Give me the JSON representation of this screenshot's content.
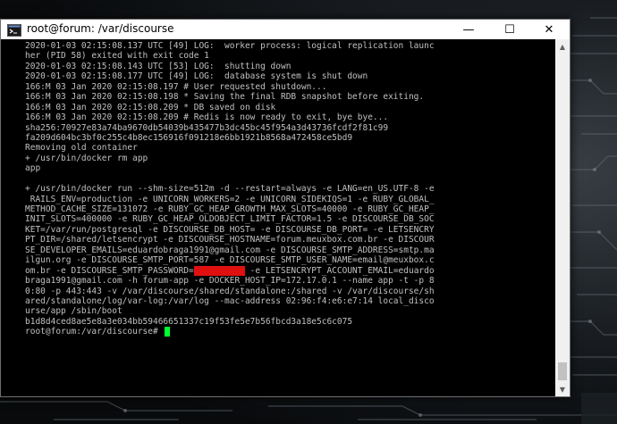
{
  "window": {
    "title": "root@forum: /var/discourse",
    "minimize_glyph": "—",
    "maximize_glyph": "☐",
    "close_glyph": "✕",
    "icon": "terminal-icon"
  },
  "terminal": {
    "lines": [
      "2020-01-03 02:15:08.137 UTC [49] LOG:  worker process: logical replication launc",
      "her (PID 58) exited with exit code 1",
      "2020-01-03 02:15:08.143 UTC [53] LOG:  shutting down",
      "2020-01-03 02:15:08.177 UTC [49] LOG:  database system is shut down",
      "166:M 03 Jan 2020 02:15:08.197 # User requested shutdown...",
      "166:M 03 Jan 2020 02:15:08.198 * Saving the final RDB snapshot before exiting.",
      "166:M 03 Jan 2020 02:15:08.209 * DB saved on disk",
      "166:M 03 Jan 2020 02:15:08.209 # Redis is now ready to exit, bye bye...",
      "sha256:70927e83a74ba9670db54039b435477b3dc45bc45f954a3d43736fcdf2f81c99",
      "fa209d604bc3bf0c255c4b8ec156916f091218e6bb1921b8568a472458ce5bd9",
      "Removing old container",
      "+ /usr/bin/docker rm app",
      "app",
      "",
      "+ /usr/bin/docker run --shm-size=512m -d --restart=always -e LANG=en_US.UTF-8 -e",
      " RAILS_ENV=production -e UNICORN_WORKERS=2 -e UNICORN_SIDEKIQS=1 -e RUBY_GLOBAL_",
      "METHOD_CACHE_SIZE=131072 -e RUBY_GC_HEAP_GROWTH_MAX_SLOTS=40000 -e RUBY_GC_HEAP_",
      "INIT_SLOTS=400000 -e RUBY_GC_HEAP_OLDOBJECT_LIMIT_FACTOR=1.5 -e DISCOURSE_DB_SOC",
      "KET=/var/run/postgresql -e DISCOURSE_DB_HOST= -e DISCOURSE_DB_PORT= -e LETSENCRY",
      "PT_DIR=/shared/letsencrypt -e DISCOURSE_HOSTNAME=forum.meuxbox.com.br -e DISCOUR",
      "SE_DEVELOPER_EMAILS=eduardobraga1991@gmail.com -e DISCOURSE_SMTP_ADDRESS=smtp.ma",
      "ilgun.org -e DISCOURSE_SMTP_PORT=587 -e DISCOURSE_SMTP_USER_NAME=email@meuxbox.c"
    ],
    "password_line": {
      "before": "om.br -e DISCOURSE_SMTP_PASSWORD=",
      "redacted": "xxxxxxxxxx",
      "after": " -e LETSENCRYPT_ACCOUNT_EMAIL=eduardo"
    },
    "lines_after": [
      "braga1991@gmail.com -h forum-app -e DOCKER_HOST_IP=172.17.0.1 --name app -t -p 8",
      "0:80 -p 443:443 -v /var/discourse/shared/standalone:/shared -v /var/discourse/sh",
      "ared/standalone/log/var-log:/var/log --mac-address 02:96:f4:e6:e7:14 local_disco",
      "urse/app /sbin/boot",
      "b1d8d4ced8ae5e8a3e034bb59466651337c19f53fe5e7b56fbcd3a18e5c6c075"
    ],
    "prompt": "root@forum:/var/discourse# "
  },
  "colors": {
    "terminal_bg": "#000000",
    "terminal_fg": "#c0c0c0",
    "cursor": "#00ff30",
    "redaction": "#e01010"
  }
}
